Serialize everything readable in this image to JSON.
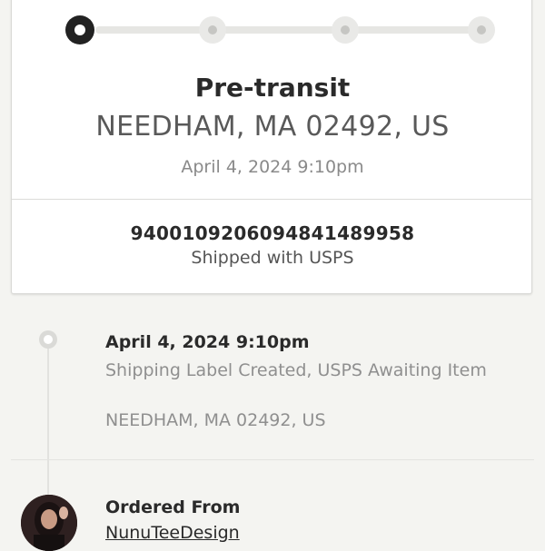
{
  "progress": {
    "steps": 4,
    "active_step": 1
  },
  "status": {
    "title": "Pre-transit",
    "location": "NEEDHAM, MA 02492, US",
    "timestamp": "April 4, 2024 9:10pm"
  },
  "shipment": {
    "tracking_number": "9400109206094841489958",
    "carrier_text": "Shipped with USPS"
  },
  "timeline": [
    {
      "time": "April 4, 2024 9:10pm",
      "description": "Shipping Label Created, USPS Awaiting Item",
      "location": "NEEDHAM, MA 02492, US"
    }
  ],
  "ordered_from": {
    "label": "Ordered From",
    "shop_name": "NunuTeeDesign"
  },
  "colors": {
    "background": "#f4f4f1",
    "card": "#ffffff",
    "active_step": "#222222",
    "inactive_step": "#e9e9e7",
    "muted_text": "#8f8f8f"
  }
}
